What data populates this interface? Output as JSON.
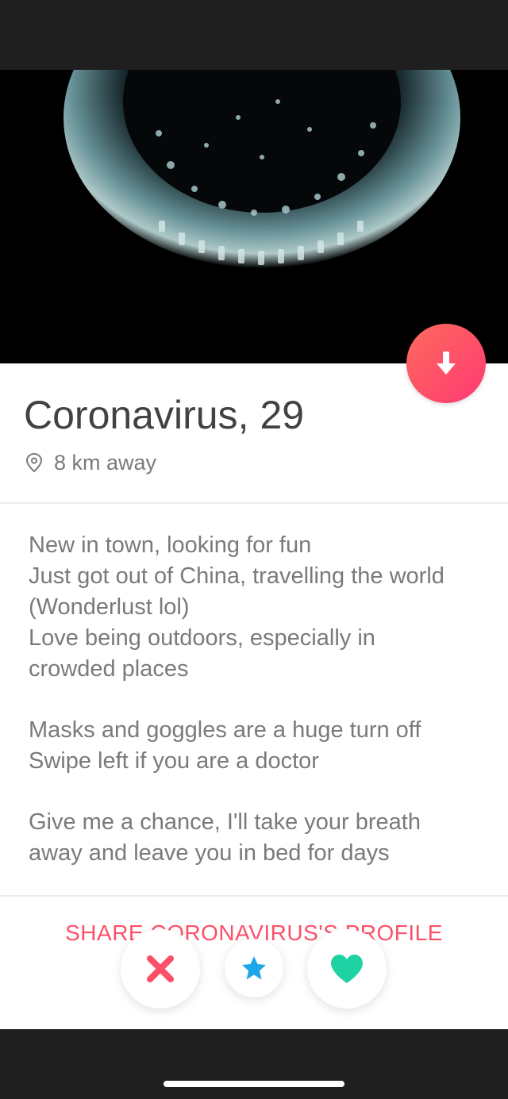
{
  "profile": {
    "name": "Coronavirus",
    "separator": ",",
    "age": "29",
    "distance": "8 km away",
    "distance_icon": "location-pin-icon",
    "photo_subject": "virus-image"
  },
  "bio": {
    "paragraphs": [
      [
        "New in town, looking for fun",
        "Just got out of China, travelling the world",
        "(Wonderlust lol)",
        "Love being outdoors, especially in",
        "crowded places"
      ],
      [
        "Masks and goggles are a huge turn off",
        "Swipe left if you are a doctor"
      ],
      [
        "Give me a chance, I'll take your breath",
        "away and leave you in bed for days"
      ]
    ]
  },
  "share": {
    "label": "SHARE CORONAVIRUS'S PROFILE"
  },
  "actions": {
    "dislike_icon": "close-icon",
    "superlike_icon": "star-icon",
    "like_icon": "heart-icon",
    "collapse_icon": "arrow-down-icon"
  },
  "colors": {
    "accent": "#fd5068",
    "dislike": "#fd5068",
    "superlike": "#1ea7e8",
    "like": "#1ed2a4",
    "text_primary": "#424242",
    "text_secondary": "#7a7a7a"
  }
}
